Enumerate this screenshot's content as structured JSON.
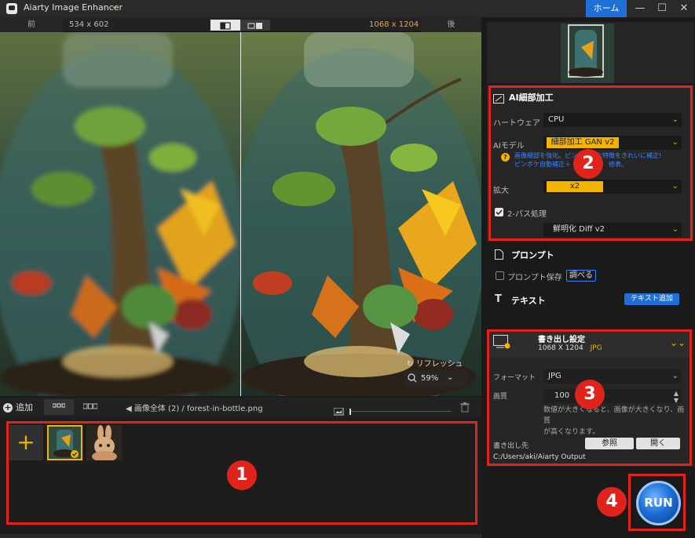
{
  "titlebar": {
    "app_title": "Aiarty Image Enhancer",
    "home_label": "ホーム",
    "minimize_icon": "—",
    "maximize_icon": "☐",
    "close_icon": "✕"
  },
  "compare": {
    "before_label": "前",
    "before_size": "534 x 602",
    "after_size": "1068 x 1204",
    "after_label": "後",
    "refresh_label": "リフレッシュ",
    "zoom_value": "59%"
  },
  "bottom_bar": {
    "add_label": "追加",
    "breadcrumb_folder": "画像全体 (2)",
    "breadcrumb_sep": "/",
    "breadcrumb_file": "forest-in-bottle.png"
  },
  "thumbnails": {
    "add_icon": "+",
    "items": [
      {
        "name": "forest-in-bottle.png",
        "selected": true
      },
      {
        "name": "bunny",
        "selected": false
      }
    ]
  },
  "ai_panel": {
    "title": "AI細部加工",
    "hardware_label": "ハートウェア",
    "hardware_value": "CPU",
    "model_label": "AIモデル",
    "model_value": "細部加工 GAN v2",
    "model_hint_line1": "画像細部を強化。ピンボケ細な特徴をきれいに補正!",
    "model_hint_line2": "ピンボケ自動補正＋　　　　　　修表。",
    "scale_label": "拡大",
    "scale_value": "x2",
    "twopass_label": "2-パス処理",
    "twopass_checked": true,
    "twopass_value": "鮮明化 Diff v2"
  },
  "prompt_panel": {
    "title": "プロンプト",
    "save_label": "プロンプト保存",
    "lookup_label": "調べる"
  },
  "text_panel": {
    "title": "テキスト",
    "add_label": "テキスト追加"
  },
  "export_panel": {
    "title": "書き出し設定",
    "size": "1068 X 1204",
    "format_short": "JPG",
    "format_label": "フォーマット",
    "format_value": "JPG",
    "quality_label": "画質",
    "quality_value": "100",
    "quality_note_line1": "数値が大きくなると、画像が大きくなり、画質",
    "quality_note_line2": "が高くなります。",
    "dest_label": "書き出し先",
    "browse_label": "参照",
    "open_label": "開く",
    "dest_path": "C:/Users/aki/Aiarty Output"
  },
  "run_label": "RUN",
  "badges": [
    "1",
    "2",
    "3",
    "4"
  ],
  "colors": {
    "accent": "#f2b400",
    "primary": "#1f6fd6",
    "annotation_red": "#e0241c",
    "after_size": "#f2a43a",
    "hint_blue": "#3a86ff"
  }
}
